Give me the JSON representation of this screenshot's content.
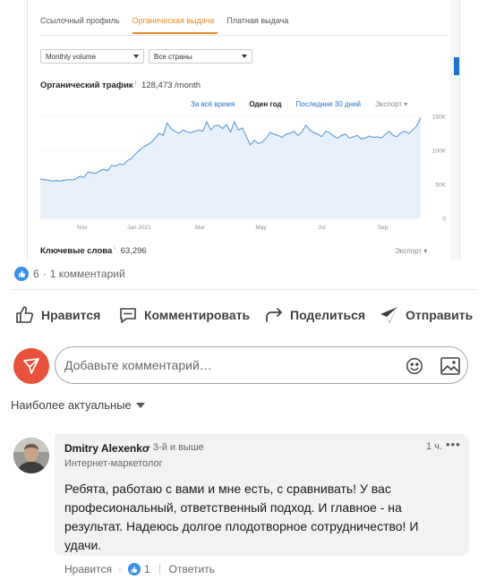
{
  "embedded": {
    "tabs": [
      "Ссылочный профиль",
      "Органическая выдача",
      "Платная выдача"
    ],
    "active_tab": "Органическая выдача",
    "select_metric": "Monthly volume",
    "select_country": "Все страны",
    "traffic_label": "Органический трафик",
    "traffic_value": "128,473 /month",
    "info_mark": "i",
    "ranges": [
      "За всё время",
      "Один год",
      "Последние 30 дней"
    ],
    "active_range": "Один год",
    "export_label": "Экспорт",
    "keywords_label": "Ключевые слова",
    "keywords_value": "63,296",
    "accent_color": "#e58c24",
    "link_color": "#1e74c8"
  },
  "chart_data": {
    "type": "area",
    "x_tick_labels": [
      "Nov",
      "Jan 2021",
      "Mar",
      "May",
      "Jul",
      "Sep"
    ],
    "y_tick_labels": [
      "150K",
      "100K",
      "50K",
      "0"
    ],
    "ylim": [
      0,
      150000
    ],
    "grid": true,
    "series": [
      {
        "values": [
          58000,
          57000,
          56000,
          55000,
          55500,
          55000,
          56000,
          57000,
          56500,
          58000,
          62000,
          60000,
          68000,
          67000,
          66000,
          70000,
          72000,
          70000,
          78000,
          77000,
          80000,
          79000,
          85000,
          88000,
          95000,
          100000,
          105000,
          108000,
          112000,
          118000,
          125000,
          122000,
          140000,
          132000,
          128000,
          125000,
          130000,
          127000,
          126000,
          128000,
          130000,
          128000,
          142000,
          130000,
          136000,
          137000,
          132000,
          138000,
          127000,
          142000,
          130000,
          133000,
          120000,
          108000,
          115000,
          110000,
          112000,
          118000,
          126000,
          124000,
          122000,
          119000,
          124000,
          125000,
          128000,
          122000,
          127000,
          137000,
          130000,
          126000,
          124000,
          120000,
          128000,
          126000,
          121000,
          118000,
          122000,
          124000,
          118000,
          120000,
          122000,
          117000,
          118000,
          121000,
          119000,
          120000,
          118000,
          123000,
          128000,
          122000,
          120000,
          126000,
          128000,
          125000,
          130000,
          136000,
          148000
        ]
      }
    ]
  },
  "post": {
    "reactions_count": "6",
    "comments_count": "1 комментарий",
    "separator": "·",
    "like_label": "Нравится",
    "comment_label": "Комментировать",
    "share_label": "Поделиться",
    "send_label": "Отправить"
  },
  "comment_input": {
    "placeholder": "Добавьте комментарий…"
  },
  "sort": {
    "label": "Наиболее актуальные"
  },
  "comment": {
    "author": "Dmitry Alexenko",
    "degree": "• 3-й и выше",
    "headline": "Интернет-маркетолог",
    "time": "1 ч.",
    "more": "•••",
    "text": "Ребята, работаю с вами и мне есть, с сравнивать! У вас професиональный, ответственный подход. И главное - на результат. Надеюсь долгое плодотворное сотрудничество! И удачи.",
    "like_label": "Нравится",
    "like_count": "1",
    "reply_label": "Ответить",
    "dot": "·"
  },
  "colors": {
    "brand_blue": "#378fe9",
    "logo_red": "#e8513a"
  }
}
